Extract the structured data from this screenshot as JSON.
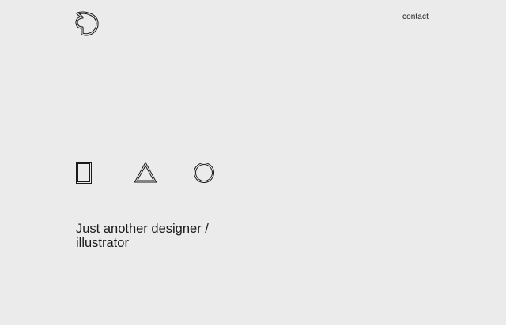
{
  "header": {
    "logo_icon": "d-shaped-logo-icon",
    "contact_label": "contact"
  },
  "shapes": [
    {
      "name": "rectangle-outline-icon"
    },
    {
      "name": "triangle-outline-icon"
    },
    {
      "name": "circle-outline-icon"
    }
  ],
  "hero": {
    "tagline_line1": "Just another designer /",
    "tagline_line2": "illustrator"
  },
  "colors": {
    "background": "#ebebeb",
    "text": "#1a1a1a"
  }
}
